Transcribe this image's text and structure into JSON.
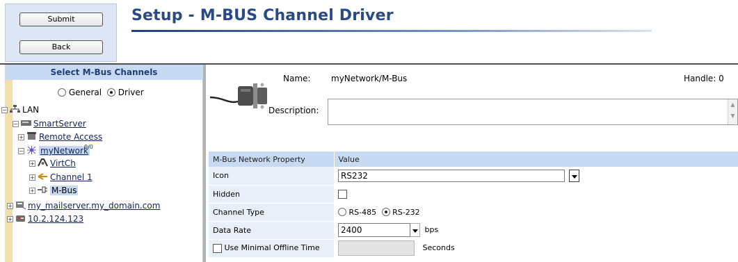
{
  "toolbar": {
    "submit_label": "Submit",
    "back_label": "Back"
  },
  "page": {
    "title": "Setup - M-BUS Channel Driver"
  },
  "left": {
    "header": "Select M-Bus Channels",
    "mode": {
      "general_label": "General",
      "driver_label": "Driver",
      "selected": "Driver"
    },
    "tree": {
      "lan": "LAN",
      "smartserver": "SmartServer",
      "remote_access": "Remote Access",
      "mynetwork": "myNetwork",
      "mynetwork_badge": "0/0",
      "virtch": "VirtCh",
      "channel1": "Channel 1",
      "mbus": "M-Bus",
      "mailserver": "my_mailserver.my_domain.com",
      "ip": "10.2.124.123"
    }
  },
  "form": {
    "name_label": "Name:",
    "name_value": "myNetwork/M-Bus",
    "handle_label": "Handle: 0",
    "description_label": "Description:",
    "description_value": ""
  },
  "table": {
    "col_property": "M-Bus Network Property",
    "col_value": "Value",
    "rows": {
      "icon_label": "Icon",
      "icon_value": "RS232",
      "hidden_label": "Hidden",
      "channel_type_label": "Channel Type",
      "rs485_label": "RS-485",
      "rs232_label": "RS-232",
      "channel_type_selected": "RS-232",
      "data_rate_label": "Data Rate",
      "data_rate_value": "2400",
      "data_rate_unit": "bps",
      "min_offline_label": "Use Minimal Offline Time",
      "min_offline_unit": "Seconds"
    }
  },
  "colors": {
    "title": "#2a4a86",
    "header_bg": "#c7daf1",
    "stripe": "#f4dfaa",
    "row_key_bg": "#e9eff8"
  }
}
